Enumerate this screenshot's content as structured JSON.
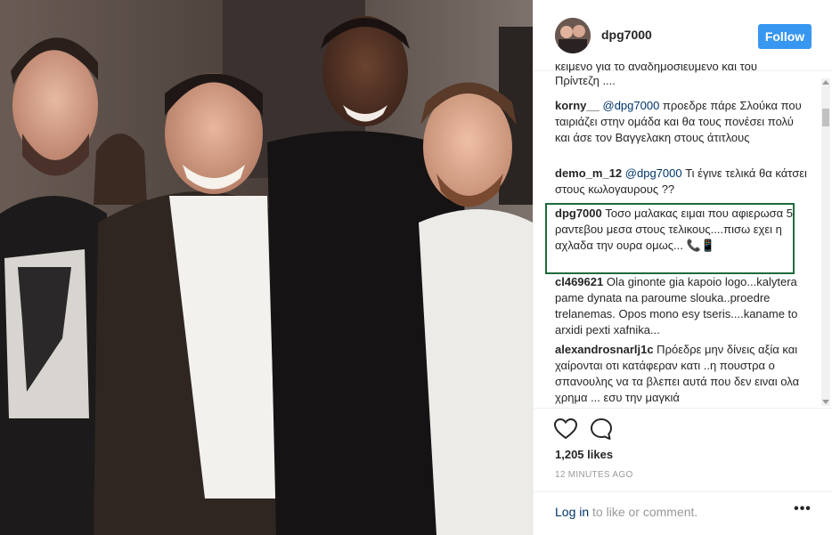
{
  "post": {
    "username": "dpg7000",
    "follow_label": "Follow",
    "likes": "1,205 likes",
    "time_ago": "12 MINUTES AGO",
    "login_link": "Log in",
    "login_suffix": " to like or comment.",
    "more_label": "•••"
  },
  "comments": [
    {
      "author": "",
      "text": "κειμενο για το αναδημοσιευμενο και του",
      "text2": "Πρίντεζη ...."
    },
    {
      "author": "korny__",
      "mention": "@dpg7000",
      "text": " προεδρε πάρε Σλούκα που ταιριάζει στην ομάδα και θα τους πονέσει πολύ και άσε τον Βαγγελακη στους άτιτλους"
    },
    {
      "author": "demo_m_12",
      "mention": "@dpg7000",
      "text": " Τι έγινε τελικά θα κάτσει στους κωλογαυρους ??"
    },
    {
      "author": "dpg7000",
      "text": " Τοσο μαλακας ειμαι που αφιερωσα 5 ραντεβου μεσα στους τελικους....πισω εχει η αχλαδα την ουρα ομως...",
      "emoji": "📞📱"
    },
    {
      "author": "cl469621",
      "text": " Ola ginonte gia kapoio logo...kalytera pame dynata na paroume slouka..proedre trelanemas. Opos mono esy tseris....kaname to arxidi pexti xafnika..."
    },
    {
      "author": "alexandrosnarlj1c",
      "text": " Πρόεδρε μην δίνεις αξία και χαίρονται οτι κατάφεραν κατι ..η πουστρα ο σπανουλης να τα βλεπει αυτά που δεν ειναι ολα χρημα ... εσυ την μαγκιά"
    }
  ],
  "colors": {
    "accent": "#3897f0",
    "link": "#003569",
    "highlight": "#1d6b3c"
  },
  "icons": [
    "heart-icon",
    "comment-icon",
    "more-icon"
  ]
}
